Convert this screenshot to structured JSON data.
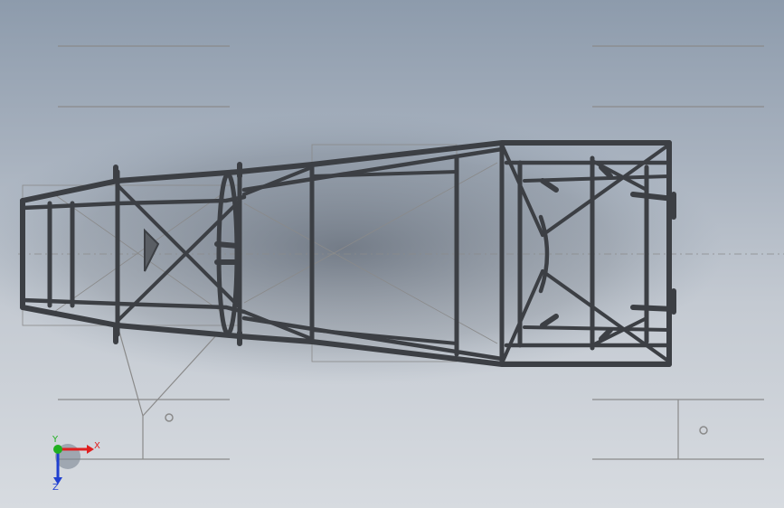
{
  "viewport": {
    "background_top": "#8d9bac",
    "background_bottom": "#d7dbe0",
    "tube_color": "#3c3f44",
    "sketch_color": "#8a8a8a"
  },
  "triad": {
    "x_label": "X",
    "y_label": "Y",
    "z_label": "Z",
    "x_color": "#e02020",
    "y_color": "#20b020",
    "z_color": "#2040d0"
  }
}
